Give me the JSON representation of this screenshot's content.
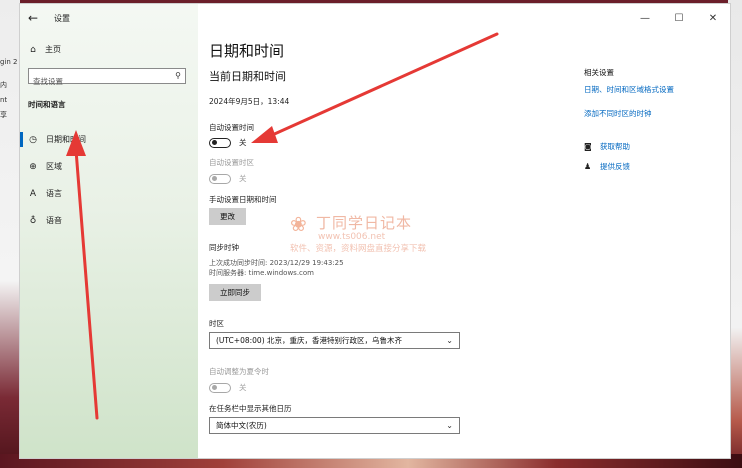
{
  "background": {
    "fragments": [
      "gin 2",
      "内",
      "nt",
      "享"
    ]
  },
  "window": {
    "title": "设置",
    "back_icon": "arrow-left-icon",
    "controls": {
      "minimize": "—",
      "maximize": "☐",
      "close": "✕"
    }
  },
  "sidebar": {
    "home_label": "主页",
    "search_placeholder": "查找设置",
    "section_title": "时间和语言",
    "items": [
      {
        "label": "日期和时间",
        "icon": "clock-calendar-icon",
        "active": true
      },
      {
        "label": "区域",
        "icon": "region-icon",
        "active": false
      },
      {
        "label": "语言",
        "icon": "language-icon",
        "active": false
      },
      {
        "label": "语音",
        "icon": "microphone-icon",
        "active": false
      }
    ]
  },
  "main": {
    "page_title": "日期和时间",
    "current_section": "当前日期和时间",
    "current_datetime": "2024年9月5日，13:44",
    "auto_time": {
      "label": "自动设置时间",
      "state": "关"
    },
    "auto_timezone": {
      "label": "自动设置时区",
      "state": "关"
    },
    "manual": {
      "label": "手动设置日期和时间",
      "button": "更改"
    },
    "sync": {
      "label": "同步时钟",
      "last_sync": "上次成功同步时间: 2023/12/29 19:43:25",
      "server": "时间服务器: time.windows.com",
      "button": "立即同步"
    },
    "timezone": {
      "label": "时区",
      "value": "(UTC+08:00) 北京，重庆，香港特别行政区，乌鲁木齐"
    },
    "dst": {
      "label": "自动调整为夏令时",
      "state": "关"
    },
    "calendar": {
      "label": "在任务栏中显示其他日历",
      "value": "简体中文(农历)"
    }
  },
  "related": {
    "title": "相关设置",
    "links": [
      "日期、时间和区域格式设置",
      "添加不同时区的时钟"
    ]
  },
  "help": {
    "get_help": "获取帮助",
    "feedback": "提供反馈"
  },
  "watermark": {
    "title": "丁同学日记本",
    "url": "www.ts006.net",
    "subtitle": "软件、资源，资料网盘直接分享下载"
  },
  "colors": {
    "accent": "#0067c0",
    "annotation": "#e53935"
  }
}
